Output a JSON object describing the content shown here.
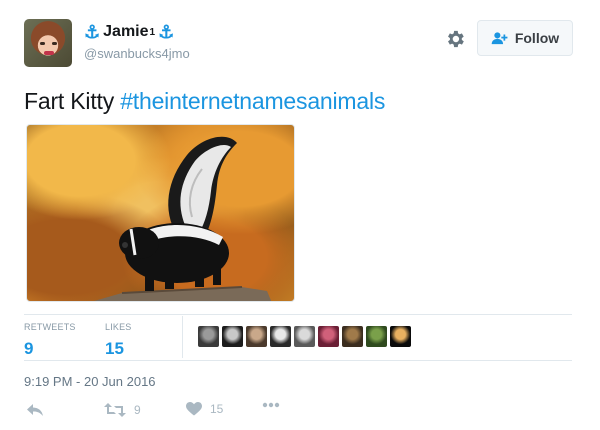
{
  "user": {
    "display_name": "Jamie",
    "display_suffix": "1",
    "handle": "@swanbucks4jmo",
    "anchor_icon": "anchor-icon",
    "accent_color": "#1b95e0"
  },
  "header": {
    "follow_label": "Follow",
    "gear_icon": "gear-icon"
  },
  "tweet": {
    "text": "Fart Kitty ",
    "hashtag": "#theinternetnamesanimals"
  },
  "stats": {
    "retweets_label": "RETWEETS",
    "retweets_value": "9",
    "likes_label": "LIKES",
    "likes_value": "15"
  },
  "likers": [
    {
      "name": "liker-avatar-1",
      "colors": [
        "#3a3a3a",
        "#9a9a9a"
      ]
    },
    {
      "name": "liker-avatar-2",
      "colors": [
        "#1c1c1c",
        "#c8c8c8"
      ]
    },
    {
      "name": "liker-avatar-3",
      "colors": [
        "#4b3a2c",
        "#c9a88a"
      ]
    },
    {
      "name": "liker-avatar-4",
      "colors": [
        "#2a2a2a",
        "#e8e8e8"
      ]
    },
    {
      "name": "liker-avatar-5",
      "colors": [
        "#5a5a5a",
        "#dadada"
      ]
    },
    {
      "name": "liker-avatar-6",
      "colors": [
        "#6b1f35",
        "#d0607a"
      ]
    },
    {
      "name": "liker-avatar-7",
      "colors": [
        "#3b2d1f",
        "#a07a4a"
      ]
    },
    {
      "name": "liker-avatar-8",
      "colors": [
        "#2f4a1e",
        "#7aa04a"
      ]
    },
    {
      "name": "liker-avatar-9",
      "colors": [
        "#0a0a0a",
        "#e8b060"
      ]
    }
  ],
  "timestamp": "9:19 PM - 20 Jun 2016",
  "actions": {
    "reply_icon": "reply-icon",
    "retweet_icon": "retweet-icon",
    "retweet_count": "9",
    "like_icon": "heart-icon",
    "like_count": "15",
    "more_icon": "more-dots-icon"
  }
}
